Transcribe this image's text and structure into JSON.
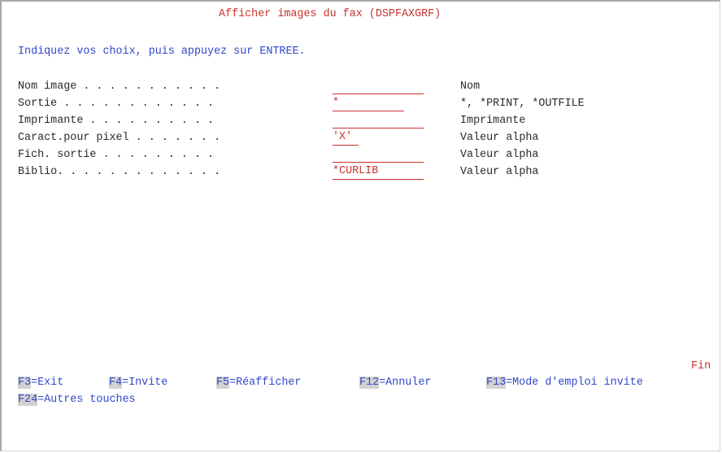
{
  "screen": {
    "title": "Afficher images du fax (DSPFAXGRF)",
    "instruction": "Indiquez vos choix, puis appuyez sur ENTREE.",
    "end_marker": "Fin"
  },
  "fields": [
    {
      "label": "Nom image . . . . . . . . . . .",
      "value": "",
      "hint": "Nom"
    },
    {
      "label": "Sortie . . . . . . . . . . . .",
      "value": "*",
      "hint": "*, *PRINT, *OUTFILE"
    },
    {
      "label": "Imprimante . . . . . . . . . .",
      "value": "",
      "hint": "Imprimante"
    },
    {
      "label": "Caract.pour pixel . . . . . . .",
      "value": "'X'",
      "hint": "Valeur alpha"
    },
    {
      "label": "Fich. sortie . . . . . . . . .",
      "value": "",
      "hint": "Valeur alpha"
    },
    {
      "label": "Biblio. . . . . . . . . . . . .",
      "value": "*CURLIB",
      "hint": "Valeur alpha"
    }
  ],
  "function_keys": [
    {
      "key": "F3",
      "text": "=Exit"
    },
    {
      "key": "F4",
      "text": "=Invite"
    },
    {
      "key": "F5",
      "text": "=Réafficher"
    },
    {
      "key": "F12",
      "text": "=Annuler"
    },
    {
      "key": "F13",
      "text": "=Mode d'emploi invite"
    },
    {
      "key": "F24",
      "text": "=Autres touches"
    }
  ],
  "colors": {
    "title": "#c8322d",
    "instruction": "#2f48c8",
    "input": "#c8322d",
    "text": "#2a2a2a",
    "key_highlight": "#d2d2d2"
  }
}
